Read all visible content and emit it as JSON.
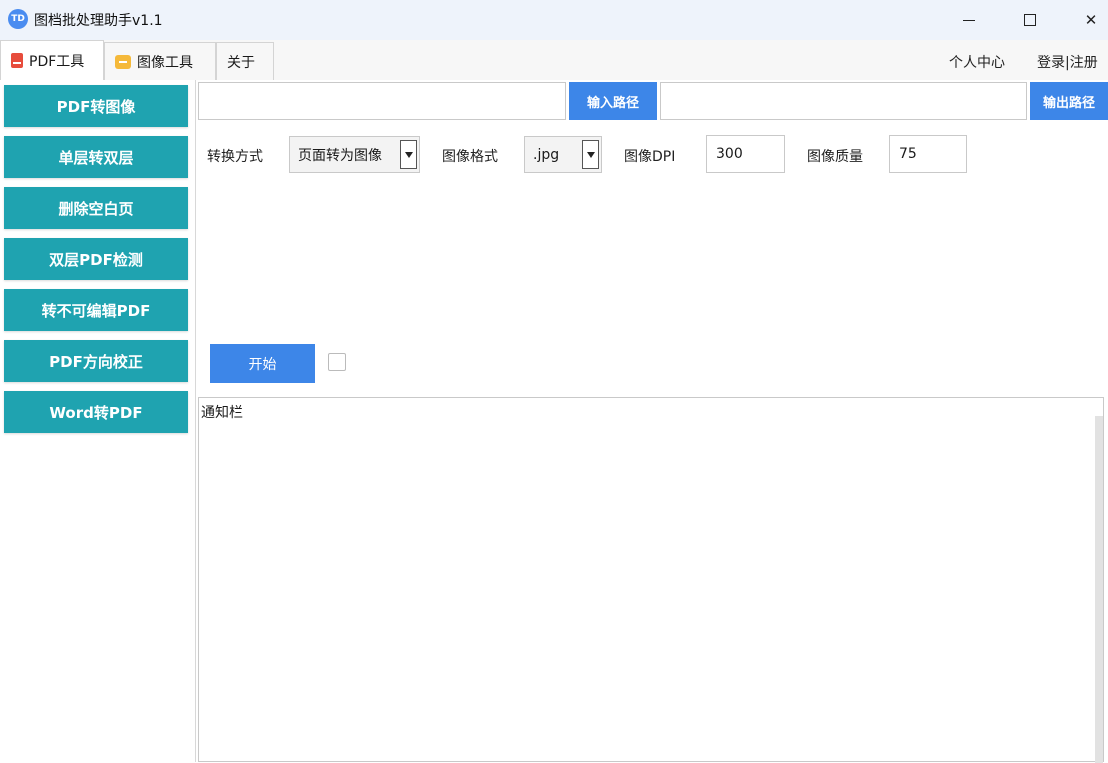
{
  "window": {
    "app_icon_text": "TD",
    "title": "图档批处理助手v1.1"
  },
  "tabs": [
    {
      "label": "PDF工具",
      "icon": "pdf-icon",
      "active": true
    },
    {
      "label": "图像工具",
      "icon": "image-icon",
      "active": false
    },
    {
      "label": "关于",
      "active": false
    }
  ],
  "top_links": {
    "personal": "个人中心",
    "login": "登录|注册"
  },
  "sidebar": {
    "items": [
      {
        "label": "PDF转图像"
      },
      {
        "label": "单层转双层"
      },
      {
        "label": "删除空白页"
      },
      {
        "label": "双层PDF检测"
      },
      {
        "label": "转不可编辑PDF"
      },
      {
        "label": "PDF方向校正"
      },
      {
        "label": "Word转PDF"
      }
    ],
    "accent_color": "#1fa3b0"
  },
  "paths": {
    "input_value": "",
    "input_button": "输入路径",
    "output_value": "",
    "output_button": "输出路径"
  },
  "options": {
    "convert_mode_label": "转换方式",
    "convert_mode_value": "页面转为图像",
    "image_format_label": "图像格式",
    "image_format_value": ".jpg",
    "dpi_label": "图像DPI",
    "dpi_value": "300",
    "quality_label": "图像质量",
    "quality_value": "75"
  },
  "actions": {
    "start_button": "开始",
    "checkbox_checked": false
  },
  "notice": {
    "text": "通知栏"
  },
  "colors": {
    "primary_blue": "#3d86e8",
    "teal": "#1fa3b0"
  }
}
